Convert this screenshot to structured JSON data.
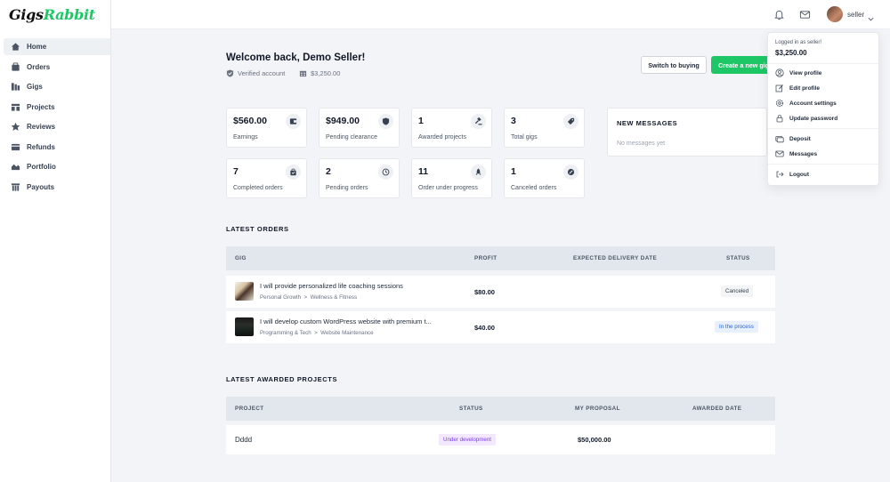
{
  "brand": {
    "part1": "Gigs",
    "part2": "Rabbit",
    "accent": "#1ec766"
  },
  "sidebar": {
    "items": [
      {
        "label": "Home",
        "icon": "home-icon",
        "active": true
      },
      {
        "label": "Orders",
        "icon": "orders-icon"
      },
      {
        "label": "Gigs",
        "icon": "gigs-icon"
      },
      {
        "label": "Projects",
        "icon": "projects-icon"
      },
      {
        "label": "Reviews",
        "icon": "star-icon"
      },
      {
        "label": "Refunds",
        "icon": "refunds-icon"
      },
      {
        "label": "Portfolio",
        "icon": "portfolio-icon"
      },
      {
        "label": "Payouts",
        "icon": "payouts-icon"
      }
    ]
  },
  "topbar": {
    "username": "seller"
  },
  "welcome": {
    "title": "Welcome back, Demo Seller!",
    "verified": "Verified account",
    "balance": "$3,250.00"
  },
  "actions": {
    "switch_label": "Switch to buying",
    "create_label": "Create a new gig"
  },
  "stats": [
    {
      "value": "$560.00",
      "label": "Earnings",
      "icon": "wallet-icon"
    },
    {
      "value": "$949.00",
      "label": "Pending clearance",
      "icon": "shield-icon"
    },
    {
      "value": "1",
      "label": "Awarded projects",
      "icon": "gavel-icon"
    },
    {
      "value": "3",
      "label": "Total gigs",
      "icon": "tag-icon"
    },
    {
      "value": "7",
      "label": "Completed orders",
      "icon": "bag-check-icon"
    },
    {
      "value": "2",
      "label": "Pending orders",
      "icon": "history-icon"
    },
    {
      "value": "11",
      "label": "Order under progress",
      "icon": "rocket-icon"
    },
    {
      "value": "1",
      "label": "Canceled orders",
      "icon": "cancel-icon"
    }
  ],
  "messages": {
    "title": "NEW MESSAGES",
    "empty": "No messages yet"
  },
  "orders": {
    "title": "LATEST ORDERS",
    "headers": {
      "gig": "GIG",
      "profit": "PROFIT",
      "delivery": "EXPECTED DELIVERY DATE",
      "status": "STATUS"
    },
    "rows": [
      {
        "title": "I will provide personalized life coaching sessions",
        "cat1": "Personal Growth",
        "cat2": "Wellness & Fitness",
        "profit": "$80.00",
        "status": "Canceled",
        "status_color": "#374151",
        "status_bg": "#f3f4f6"
      },
      {
        "title": "I will develop custom WordPress website with premium t...",
        "cat1": "Programming & Tech",
        "cat2": "Website Maintenance",
        "profit": "$40.00",
        "status": "In the process",
        "status_color": "#2563eb",
        "status_bg": "#e8f0fe"
      }
    ]
  },
  "projects": {
    "title": "LATEST AWARDED PROJECTS",
    "headers": {
      "project": "PROJECT",
      "status": "STATUS",
      "proposal": "MY PROPOSAL",
      "awarded": "AWARDED DATE"
    },
    "rows": [
      {
        "project": "Dddd",
        "status": "Under development",
        "status_color": "#7c3aed",
        "status_bg": "#f3e8ff",
        "proposal": "$50,000.00"
      }
    ]
  },
  "dropdown": {
    "logged_in": "Logged in as seller!",
    "balance": "$3,250.00",
    "items": [
      {
        "label": "View profile",
        "icon": "user-circle-icon"
      },
      {
        "label": "Edit profile",
        "icon": "edit-icon"
      },
      {
        "label": "Account settings",
        "icon": "gear-icon"
      },
      {
        "label": "Update password",
        "icon": "lock-icon"
      },
      {
        "label": "Deposit",
        "icon": "deposit-icon"
      },
      {
        "label": "Messages",
        "icon": "mail-icon"
      },
      {
        "label": "Logout",
        "icon": "logout-icon"
      }
    ]
  }
}
